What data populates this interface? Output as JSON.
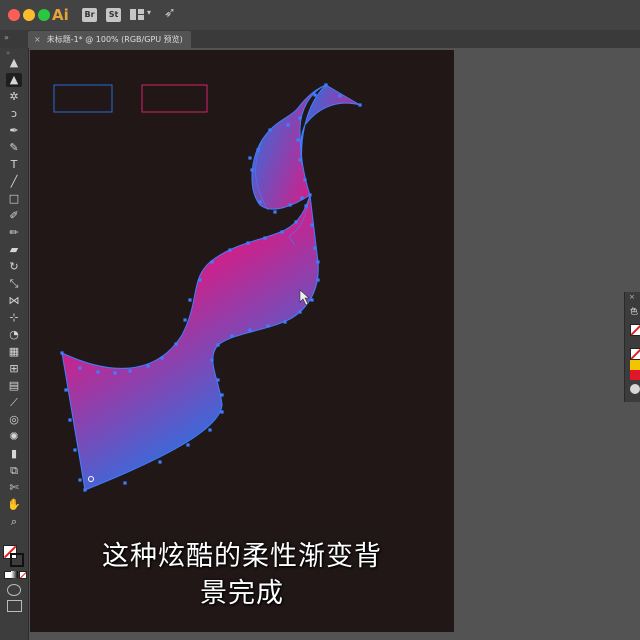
{
  "app": {
    "logo": "Ai",
    "bridge_label": "Br",
    "stock_label": "St"
  },
  "document": {
    "tab_title": "未标题-1* @ 100% (RGB/GPU 预览)",
    "close_symbol": "×"
  },
  "tools": [
    {
      "name": "selection-tool-icon",
      "glyph": "▲"
    },
    {
      "name": "direct-selection-tool-icon",
      "glyph": "▲"
    },
    {
      "name": "magic-wand-tool-icon",
      "glyph": "✲"
    },
    {
      "name": "lasso-tool-icon",
      "glyph": "ↄ"
    },
    {
      "name": "pen-tool-icon",
      "glyph": "✒"
    },
    {
      "name": "curvature-tool-icon",
      "glyph": "✎"
    },
    {
      "name": "type-tool-icon",
      "glyph": "T"
    },
    {
      "name": "line-tool-icon",
      "glyph": "╱"
    },
    {
      "name": "rectangle-tool-icon",
      "glyph": "□"
    },
    {
      "name": "paintbrush-tool-icon",
      "glyph": "✐"
    },
    {
      "name": "pencil-tool-icon",
      "glyph": "✏"
    },
    {
      "name": "eraser-tool-icon",
      "glyph": "▰"
    },
    {
      "name": "rotate-tool-icon",
      "glyph": "↻"
    },
    {
      "name": "scale-tool-icon",
      "glyph": "⤡"
    },
    {
      "name": "width-tool-icon",
      "glyph": "⋈"
    },
    {
      "name": "free-transform-tool-icon",
      "glyph": "⊹"
    },
    {
      "name": "shape-builder-tool-icon",
      "glyph": "◔"
    },
    {
      "name": "perspective-grid-tool-icon",
      "glyph": "▦"
    },
    {
      "name": "mesh-tool-icon",
      "glyph": "⊞"
    },
    {
      "name": "gradient-tool-icon",
      "glyph": "▤"
    },
    {
      "name": "eyedropper-tool-icon",
      "glyph": "⟋"
    },
    {
      "name": "blend-tool-icon",
      "glyph": "◎"
    },
    {
      "name": "symbol-sprayer-tool-icon",
      "glyph": "✺"
    },
    {
      "name": "column-graph-tool-icon",
      "glyph": "▮"
    },
    {
      "name": "artboard-tool-icon",
      "glyph": "⧉"
    },
    {
      "name": "slice-tool-icon",
      "glyph": "✄"
    },
    {
      "name": "hand-tool-icon",
      "glyph": "✋"
    },
    {
      "name": "zoom-tool-icon",
      "glyph": "⌕"
    }
  ],
  "subtitle": {
    "line1": "这种炫酷的柔性渐变背",
    "line2": "景完成"
  },
  "panel": {
    "title": "色"
  },
  "colors": {
    "gradient_start": "#e6157d",
    "gradient_end": "#2f6fe0",
    "anchor": "#3f7fff",
    "box1_stroke": "#2a6bd8",
    "box2_stroke": "#d8206e",
    "artboard": "#211717"
  }
}
